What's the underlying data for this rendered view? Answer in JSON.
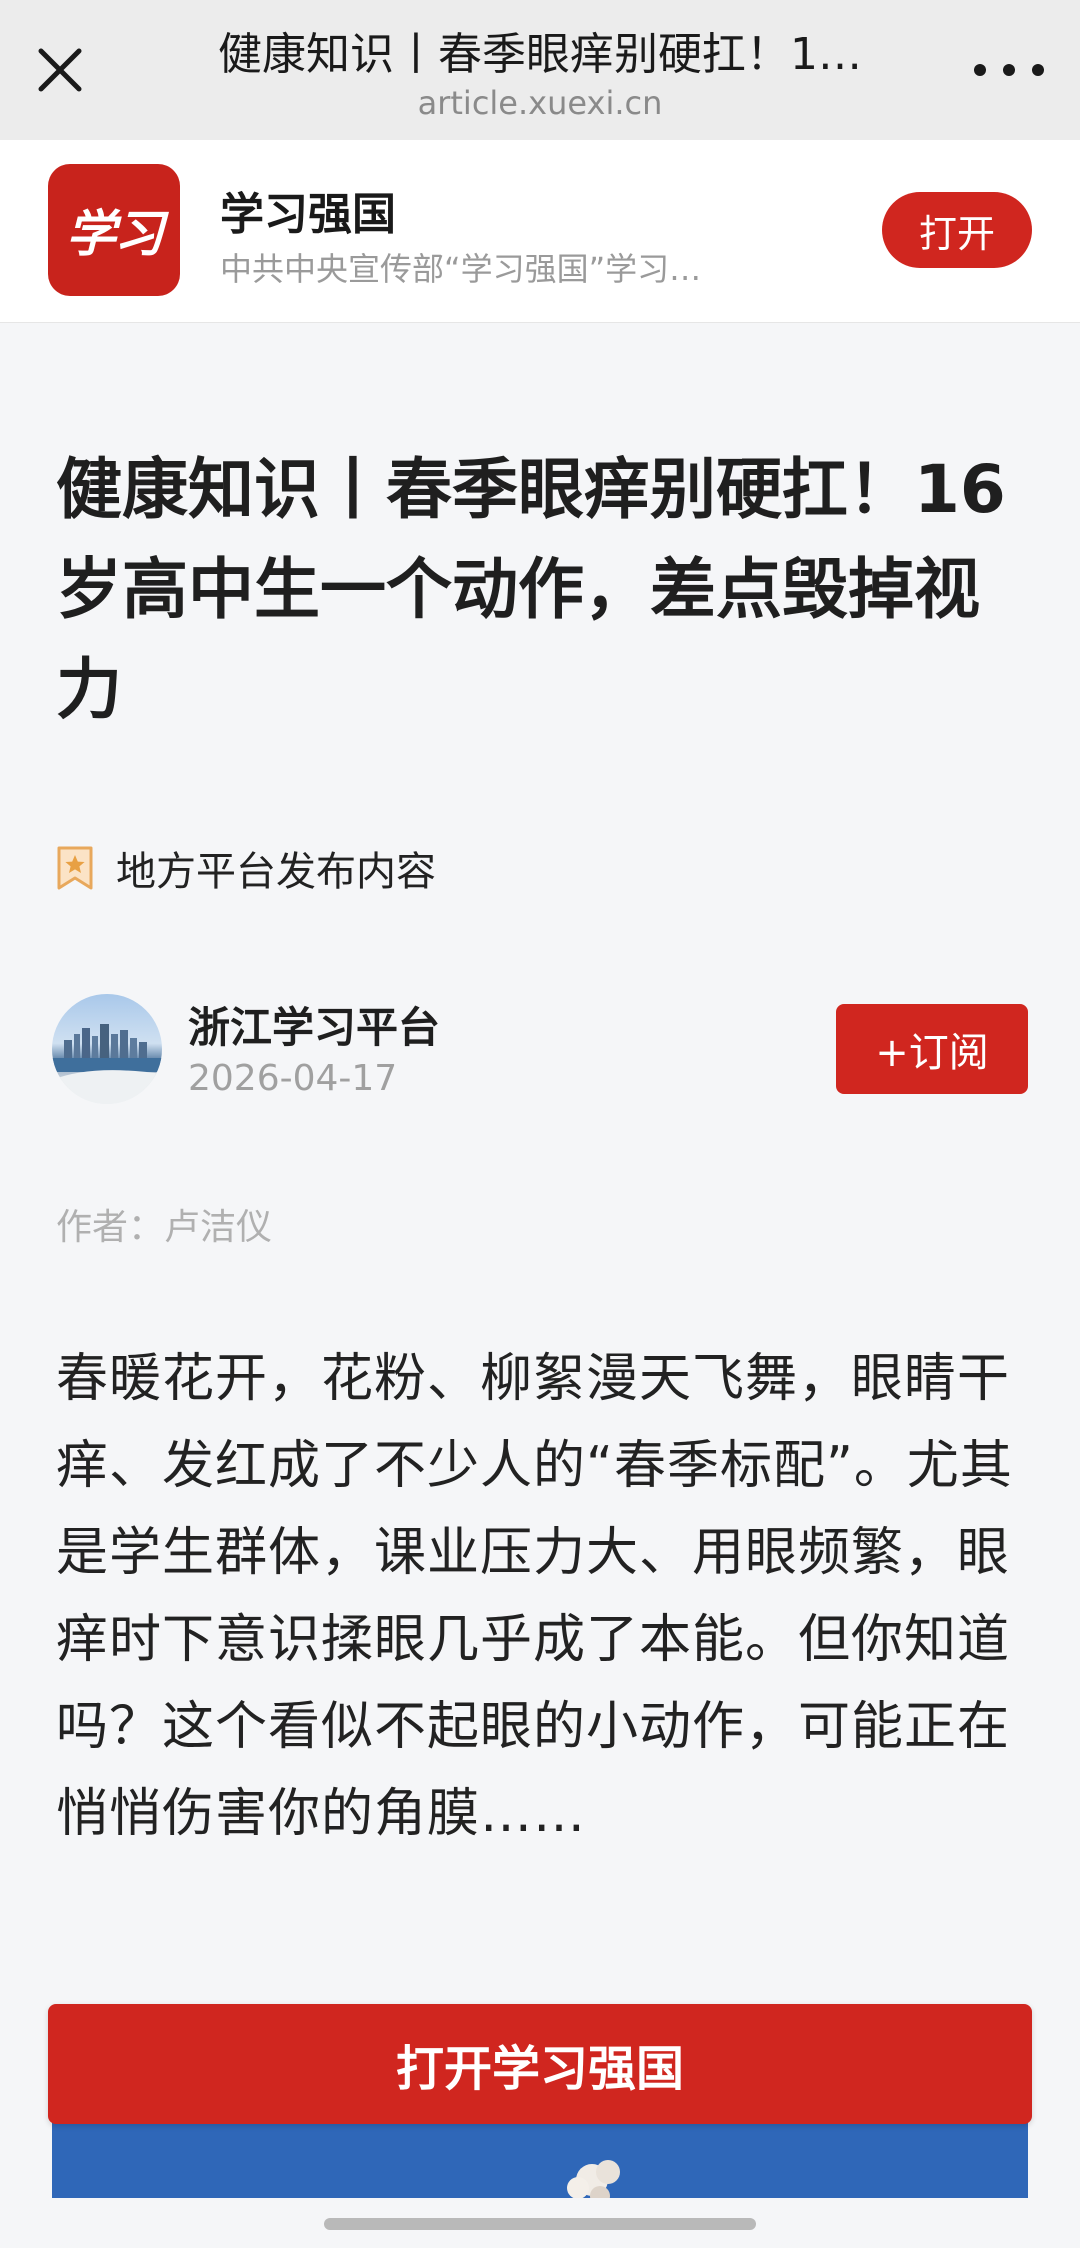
{
  "topbar": {
    "title": "健康知识丨春季眼痒别硬扛！1…",
    "url": "article.xuexi.cn"
  },
  "app_banner": {
    "logo_text": "学习",
    "name": "学习强国",
    "description": "中共中央宣传部“学习强国”学习…",
    "open_label": "打开"
  },
  "article": {
    "headline": "健康知识丨春季眼痒别硬扛！16岁高中生一个动作，差点毁掉视力",
    "tag": "地方平台发布内容",
    "source_name": "浙江学习平台",
    "date": "2026-04-17",
    "subscribe_label": "+订阅",
    "author": "作者：卢洁仪",
    "body": "春暖花开，花粉、柳絮漫天飞舞，眼睛干痒、发红成了不少人的“春季标配”。尤其是学生群体，课业压力大、用眼频繁，眼痒时下意识揉眼几乎成了本能。但你知道吗？这个看似不起眼的小动作，可能正在悄悄伤害你的角膜……"
  },
  "cta": {
    "open_app_label": "打开学习强国"
  },
  "icons": {
    "close": "close-icon",
    "more": "more-icon",
    "tag": "bookmark-star-icon",
    "avatar": "city-skyline-avatar"
  },
  "colors": {
    "accent_red": "#d0261f",
    "topbar_bg": "#ececec",
    "page_bg": "#f5f6f8"
  }
}
